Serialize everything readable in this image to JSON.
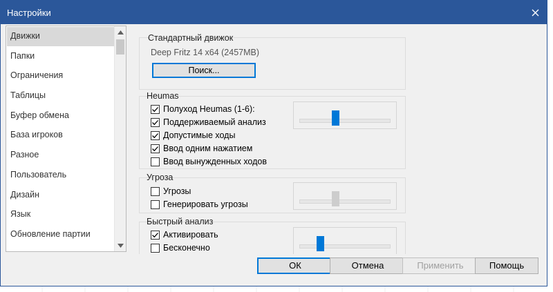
{
  "window": {
    "title": "Настройки"
  },
  "nav": {
    "items": [
      {
        "label": "Движки",
        "active": true
      },
      {
        "label": "Папки"
      },
      {
        "label": "Ограничения"
      },
      {
        "label": "Таблицы"
      },
      {
        "label": "Буфер обмена"
      },
      {
        "label": "База игроков"
      },
      {
        "label": "Разное"
      },
      {
        "label": "Пользователь"
      },
      {
        "label": "Дизайн"
      },
      {
        "label": "Язык"
      },
      {
        "label": "Обновление партии"
      }
    ]
  },
  "engine_group": {
    "title": "Стандартный движок",
    "engine_name": "Deep Fritz 14 x64  (2457MB)",
    "search_label": "Поиск..."
  },
  "heumas_group": {
    "title": "Heumas",
    "options": [
      {
        "label": "Полуход Heumas (1-6):",
        "checked": true
      },
      {
        "label": "Поддерживаемый анализ",
        "checked": true
      },
      {
        "label": "Допустимые ходы",
        "checked": true
      },
      {
        "label": "Ввод одним нажатием",
        "checked": true
      },
      {
        "label": "Ввод вынужденных ходов",
        "checked": false
      }
    ],
    "slider": {
      "value": 0.42,
      "enabled": true
    }
  },
  "threat_group": {
    "title": "Угроза",
    "options": [
      {
        "label": "Угрозы",
        "checked": false
      },
      {
        "label": "Генерировать угрозы",
        "checked": false
      }
    ],
    "slider": {
      "value": 0.42,
      "enabled": false
    }
  },
  "quick_group": {
    "title": "Быстрый анализ",
    "options": [
      {
        "label": "Активировать",
        "checked": true
      },
      {
        "label": "Бесконечно",
        "checked": false
      }
    ],
    "slider": {
      "value": 0.25,
      "enabled": true
    }
  },
  "footer": {
    "ok": "ОК",
    "cancel": "Отмена",
    "apply": "Применить",
    "help": "Помощь"
  },
  "colors": {
    "accent": "#0078d7",
    "titlebar": "#2b579a"
  }
}
